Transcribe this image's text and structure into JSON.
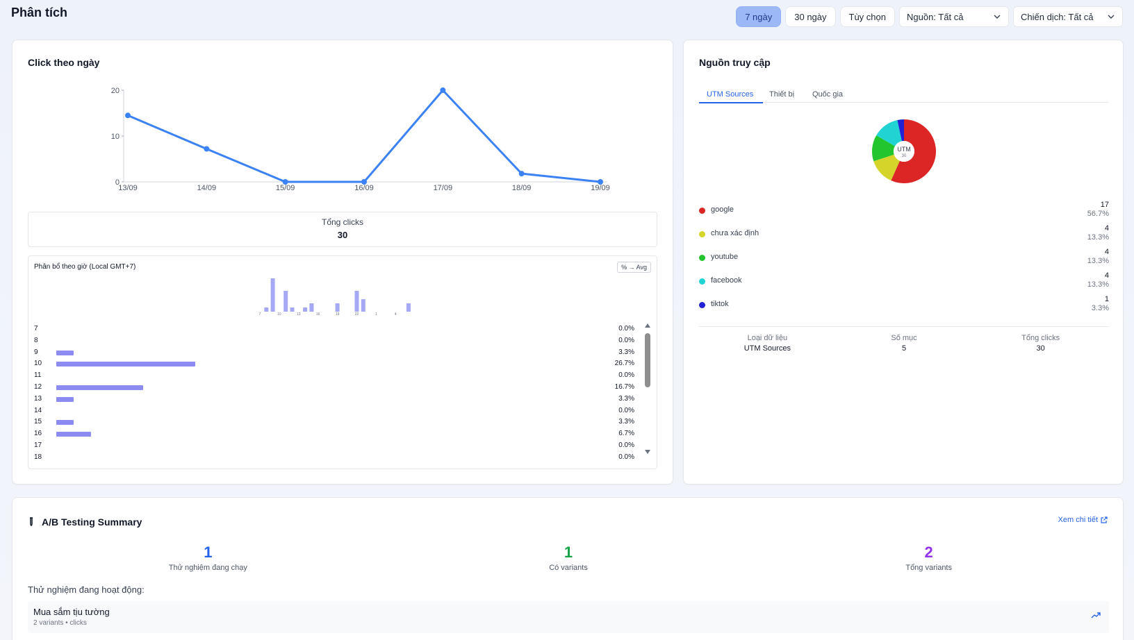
{
  "header": {
    "title": "Phân tích",
    "filters": [
      "7 ngày",
      "30 ngày",
      "Tùy chọn"
    ],
    "source_select": "Nguồn: Tất cả",
    "campaign_select": "Chiến dịch: Tất cả"
  },
  "clicks_card": {
    "title": "Click theo ngày",
    "total_label": "Tổng clicks",
    "total_value": "30"
  },
  "chart_data": {
    "type": "line",
    "x": [
      "13/09",
      "14/09",
      "15/09",
      "16/09",
      "17/09",
      "18/09",
      "19/09"
    ],
    "series": [
      {
        "values": [
          14.5,
          7.2,
          0,
          0,
          20,
          1.8,
          0
        ]
      }
    ],
    "yticks": [
      0,
      10,
      20
    ],
    "ylim": [
      0,
      20
    ],
    "color": "#3b82f6"
  },
  "hourly": {
    "title": "Phân bổ theo giờ (Local GMT+7)",
    "toggle_label": "% → Avg",
    "mini_labels": [
      "7",
      "10",
      "13",
      "16",
      "19",
      "22",
      "1",
      "4"
    ],
    "mini_values": [
      0,
      1,
      8,
      0,
      5,
      1,
      0,
      1,
      2,
      0,
      0,
      0,
      2,
      0,
      0,
      5,
      3,
      0,
      0,
      0,
      0,
      0,
      0,
      2
    ],
    "rows": [
      {
        "hour": "7",
        "pct": "0.0%",
        "value": 0
      },
      {
        "hour": "8",
        "pct": "0.0%",
        "value": 0
      },
      {
        "hour": "9",
        "pct": "3.3%",
        "value": 3.3
      },
      {
        "hour": "10",
        "pct": "26.7%",
        "value": 26.7
      },
      {
        "hour": "11",
        "pct": "0.0%",
        "value": 0
      },
      {
        "hour": "12",
        "pct": "16.7%",
        "value": 16.7
      },
      {
        "hour": "13",
        "pct": "3.3%",
        "value": 3.3
      },
      {
        "hour": "14",
        "pct": "0.0%",
        "value": 0
      },
      {
        "hour": "15",
        "pct": "3.3%",
        "value": 3.3
      },
      {
        "hour": "16",
        "pct": "6.7%",
        "value": 6.7
      },
      {
        "hour": "17",
        "pct": "0.0%",
        "value": 0
      },
      {
        "hour": "18",
        "pct": "0.0%",
        "value": 0
      }
    ]
  },
  "sources_card": {
    "title": "Nguồn truy cập",
    "tabs": [
      "UTM Sources",
      "Thiết bị",
      "Quốc gia"
    ],
    "donut_label": "UTM",
    "donut_total": "30",
    "items": [
      {
        "name": "google",
        "count": "17",
        "pct": "56.7%",
        "value": 17,
        "color": "#dc2626"
      },
      {
        "name": "chưa xác định",
        "count": "4",
        "pct": "13.3%",
        "value": 4,
        "color": "#d4d42a"
      },
      {
        "name": "youtube",
        "count": "4",
        "pct": "13.3%",
        "value": 4,
        "color": "#22c52e"
      },
      {
        "name": "facebook",
        "count": "4",
        "pct": "13.3%",
        "value": 4,
        "color": "#22d3d3"
      },
      {
        "name": "tiktok",
        "count": "1",
        "pct": "3.3%",
        "value": 1,
        "color": "#2222d4"
      }
    ],
    "summary": [
      {
        "label": "Loại dữ liệu",
        "value": "UTM Sources"
      },
      {
        "label": "Số mục",
        "value": "5"
      },
      {
        "label": "Tổng clicks",
        "value": "30"
      }
    ]
  },
  "ab": {
    "title": "A/B Testing Summary",
    "link": "Xem chi tiết",
    "stats": [
      {
        "num": "1",
        "label": "Thử nghiệm đang chạy",
        "color": "#2563eb"
      },
      {
        "num": "1",
        "label": "Có variants",
        "color": "#16a34a"
      },
      {
        "num": "2",
        "label": "Tổng variants",
        "color": "#9333ea"
      }
    ],
    "active_label": "Thử nghiệm đang hoạt động:",
    "item": {
      "name": "Mua sắm tịu tường",
      "meta": "2 variants • clicks"
    }
  }
}
